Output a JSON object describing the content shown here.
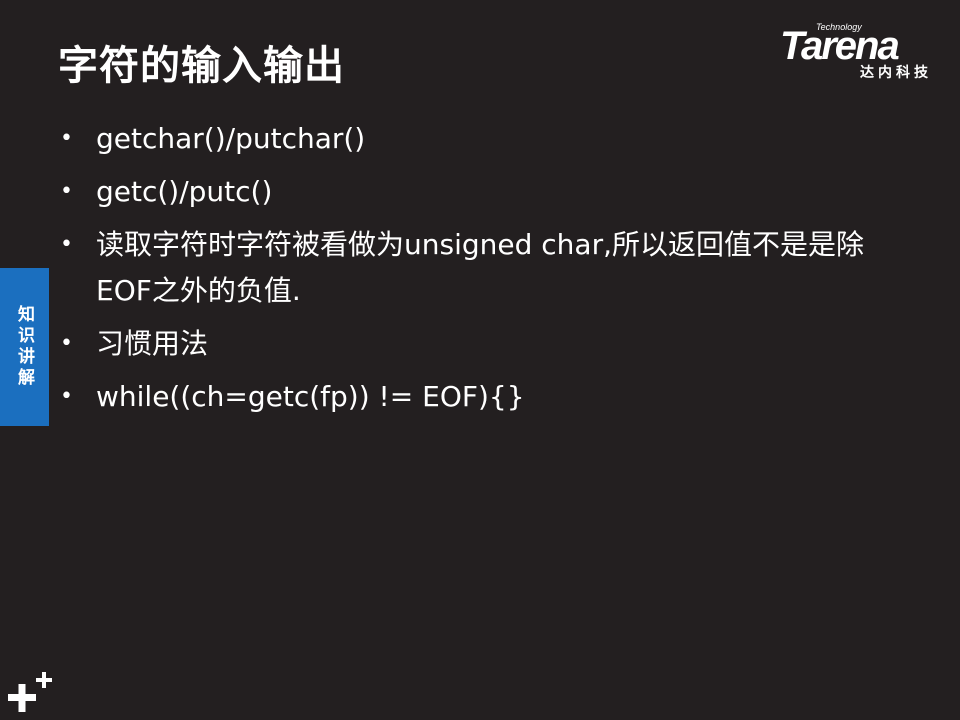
{
  "slide": {
    "title": "字符的输入输出",
    "side_tab": "知识讲解",
    "bullets": [
      "getchar()/putchar()",
      "getc()/putc()",
      "读取字符时字符被看做为unsigned char,所以返回值不是是除EOF之外的负值.",
      "习惯用法",
      "while((ch=getc(fp)) != EOF){}"
    ]
  },
  "logo": {
    "brand": "Tarena",
    "tagline": "Technology",
    "chinese": "达内科技"
  },
  "colors": {
    "background": "#231f20",
    "side_tab": "#1b6fbf",
    "text": "#ffffff"
  }
}
